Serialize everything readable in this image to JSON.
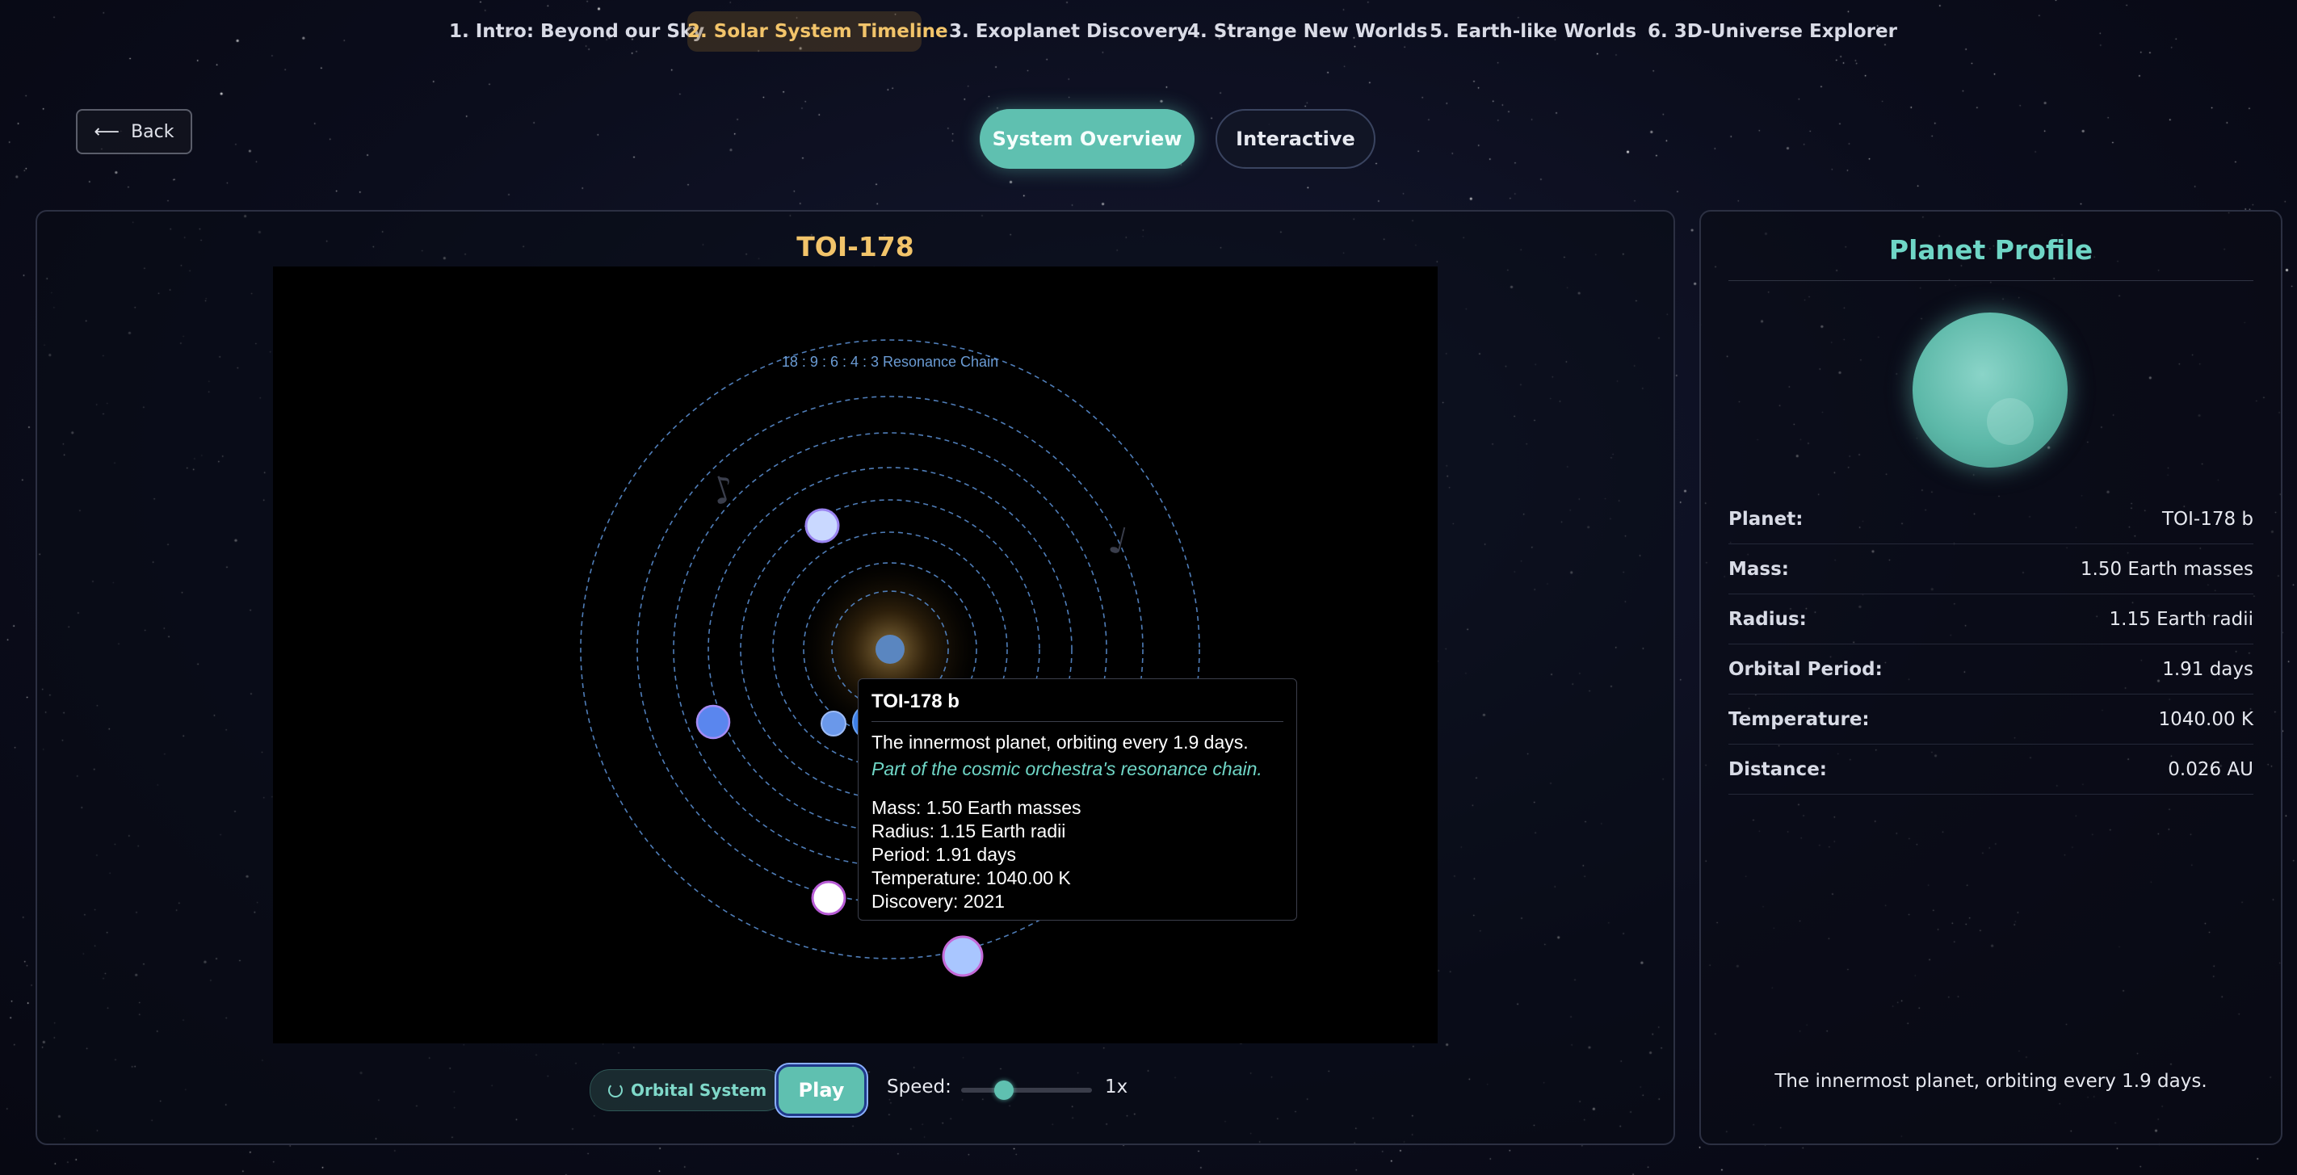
{
  "nav": {
    "tabs": [
      {
        "label": "1. Intro: Beyond our Sky",
        "active": false
      },
      {
        "label": "2. Solar System Timeline",
        "active": true
      },
      {
        "label": "3. Exoplanet Discovery",
        "active": false
      },
      {
        "label": "4. Strange New Worlds",
        "active": false
      },
      {
        "label": "5. Earth-like Worlds",
        "active": false
      },
      {
        "label": "6. 3D-Universe Explorer",
        "active": false
      }
    ]
  },
  "back_button": {
    "label": "Back",
    "icon": "arrow-left-icon"
  },
  "view_modes": {
    "overview_label": "System Overview",
    "interactive_label": "Interactive",
    "active": "System Overview"
  },
  "system": {
    "name": "TOI-178",
    "resonance_label": "18 : 9 : 6 : 4 : 3 Resonance Chain",
    "decorations": [
      "♪",
      "♩"
    ]
  },
  "tooltip": {
    "title": "TOI-178 b",
    "description": "The innermost planet, orbiting every 1.9 days.",
    "note": "Part of the cosmic orchestra's resonance chain.",
    "lines": [
      "Mass: 1.50 Earth masses",
      "Radius: 1.15 Earth radii",
      "Period: 1.91 days",
      "Temperature: 1040.00 K",
      "Discovery: 2021"
    ]
  },
  "controls": {
    "badge_label": "Orbital System",
    "play_label": "Play",
    "speed_label": "Speed:",
    "speed_value": "1x",
    "speed_fraction": 0.33
  },
  "profile": {
    "title": "Planet Profile",
    "properties": [
      {
        "label": "Planet:",
        "value": "TOI-178 b"
      },
      {
        "label": "Mass:",
        "value": "1.50 Earth masses"
      },
      {
        "label": "Radius:",
        "value": "1.15 Earth radii"
      },
      {
        "label": "Orbital Period:",
        "value": "1.91 days"
      },
      {
        "label": "Temperature:",
        "value": "1040.00 K"
      },
      {
        "label": "Distance:",
        "value": "0.026 AU"
      }
    ],
    "description": "The innermost planet, orbiting every 1.9 days."
  },
  "colors": {
    "accent": "#5fc0b0",
    "gold": "#f2c46a",
    "teal_text": "#6fd6c6",
    "orbit": "#4f7db8"
  }
}
